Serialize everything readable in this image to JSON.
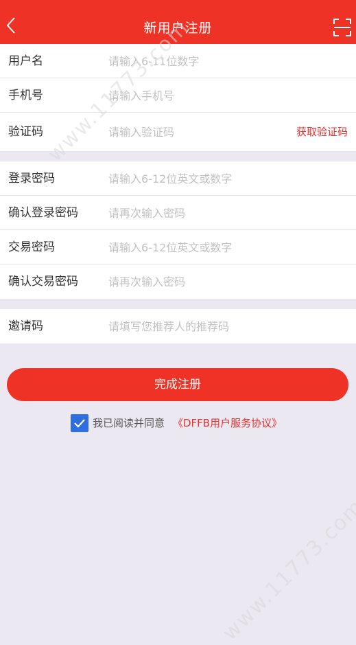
{
  "header": {
    "title": "新用户注册",
    "back_icon": "chevron-left-icon",
    "scan_icon": "scan-icon"
  },
  "group1": [
    {
      "label": "用户名",
      "placeholder": "请输入6-11位数字"
    },
    {
      "label": "手机号",
      "placeholder": "请输入手机号"
    },
    {
      "label": "验证码",
      "placeholder": "请输入验证码",
      "action": "获取验证码"
    }
  ],
  "group2": [
    {
      "label": "登录密码",
      "placeholder": "请输入6-12位英文或数字"
    },
    {
      "label": "确认登录密码",
      "placeholder": "请再次输入密码"
    },
    {
      "label": "交易密码",
      "placeholder": "请输入6-12位英文或数字"
    },
    {
      "label": "确认交易密码",
      "placeholder": "请再次输入密码"
    }
  ],
  "group3": [
    {
      "label": "邀请码",
      "placeholder": "请填写您推荐人的推荐码"
    }
  ],
  "submit_label": "完成注册",
  "agreement": {
    "checked": true,
    "text": "我已阅读并同意",
    "link": "《DFFB用户服务协议》"
  },
  "watermark": "www.11773.com",
  "colors": {
    "accent": "#ee3226",
    "checkbox": "#2f6ee0",
    "background": "#ece8f1"
  }
}
